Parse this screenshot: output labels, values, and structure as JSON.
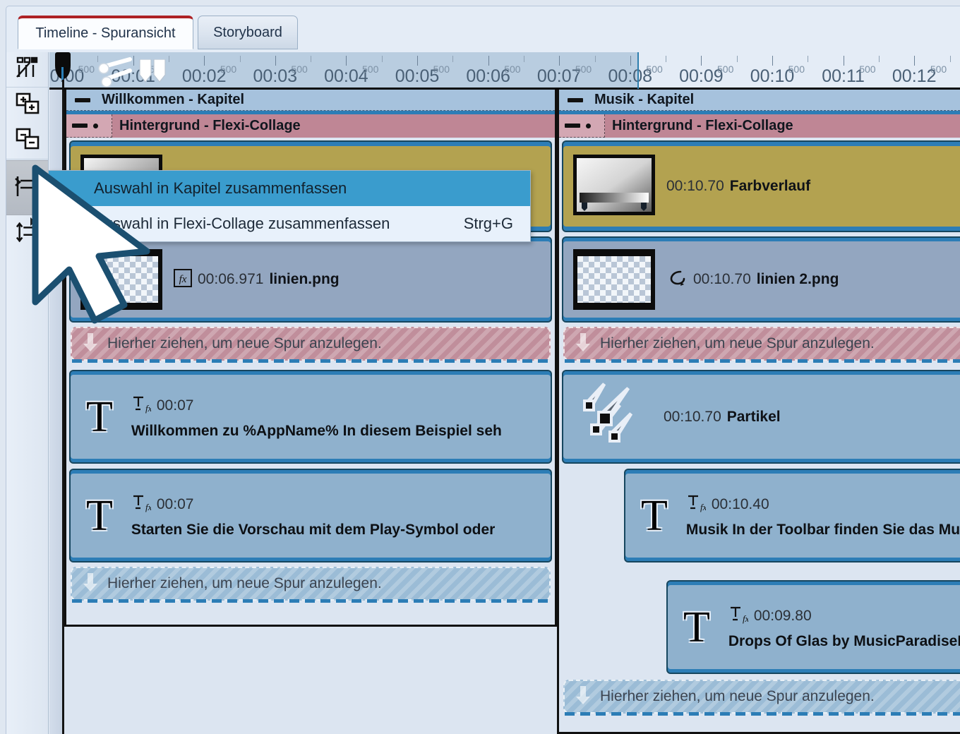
{
  "window": {
    "title": "Timeline - Spuransicht"
  },
  "tabs": [
    {
      "label": "Timeline - Spuransicht",
      "active": true
    },
    {
      "label": "Storyboard",
      "active": false
    }
  ],
  "toolbar": {
    "items": [
      {
        "name": "timeline-objects-icon",
        "label": "Objekte"
      },
      {
        "name": "add-track-icon",
        "label": "Spur hinzufügen"
      },
      {
        "name": "remove-track-icon",
        "label": "Spur entfernen"
      },
      {
        "name": "group-selection-icon",
        "label": "Auswahl zusammenfassen",
        "active": true,
        "has_submenu": true
      },
      {
        "name": "ungroup-icon",
        "label": "Gruppierung aufheben"
      }
    ]
  },
  "context_menu": {
    "items": [
      {
        "label": "Auswahl in Kapitel zusammenfassen",
        "shortcut": "",
        "selected": true
      },
      {
        "label": "Auswahl in Flexi-Collage zusammenfassen",
        "shortcut": "Strg+G",
        "selected": false
      }
    ]
  },
  "ruler": {
    "sub_label": "500",
    "labels": [
      "00:00",
      "00:01",
      "00:02",
      "00:03",
      "00:04",
      "00:05",
      "00:06",
      "00:07",
      "00:08",
      "00:09",
      "00:10",
      "00:11",
      "00:12"
    ],
    "selection_end_label": "00:07",
    "playhead_time": "00:00"
  },
  "chapters": [
    {
      "title": "Willkommen - Kapitel",
      "collage": {
        "title": "Hintergrund - Flexi-Collage"
      },
      "clips": [
        {
          "kind": "image",
          "time": "00:06.971",
          "name": "linien.png",
          "icon": "fx-icon"
        },
        {
          "kind": "text",
          "time": "00:07",
          "body": "Willkommen zu %AppName% In diesem Beispiel seh",
          "icon": "text-fx-icon"
        },
        {
          "kind": "text",
          "time": "00:07",
          "body": "Starten Sie die Vorschau mit dem Play-Symbol oder",
          "icon": "text-fx-icon"
        }
      ],
      "drop_hints": [
        "Hierher ziehen, um neue Spur anzulegen.",
        "Hierher ziehen, um neue Spur anzulegen."
      ]
    },
    {
      "title": "Musik - Kapitel",
      "collage": {
        "title": "Hintergrund - Flexi-Collage"
      },
      "clips": [
        {
          "kind": "gradient",
          "time": "00:10.70",
          "name": "Farbverlauf",
          "icon": "gradient-icon"
        },
        {
          "kind": "image",
          "time": "00:10.70",
          "name": "linien 2.png",
          "icon": "loop-icon"
        },
        {
          "kind": "particle",
          "time": "00:10.70",
          "name": "Partikel",
          "icon": "particle-icon"
        },
        {
          "kind": "text",
          "time": "00:10.40",
          "body": "Musik In der Toolbar finden Sie das Mu",
          "icon": "text-fx-icon"
        },
        {
          "kind": "text",
          "time": "00:09.80",
          "body": "Drops Of Glas by MusicParadiseL",
          "icon": "text-fx-icon"
        }
      ],
      "drop_hints": [
        "Hierher ziehen, um neue Spur anzulegen.",
        "Hierher ziehen, um neue Spur anzulegen."
      ]
    }
  ],
  "colors": {
    "accent_blue": "#2c7db6",
    "tab_accent_red": "#ae2225",
    "menu_highlight": "#3a9ccd",
    "chapter_header": "#a6c2dd",
    "collage_header": "#bf8695",
    "clip_fill": "#8fb1cd",
    "gradient_clip_fill": "#b3a250"
  }
}
